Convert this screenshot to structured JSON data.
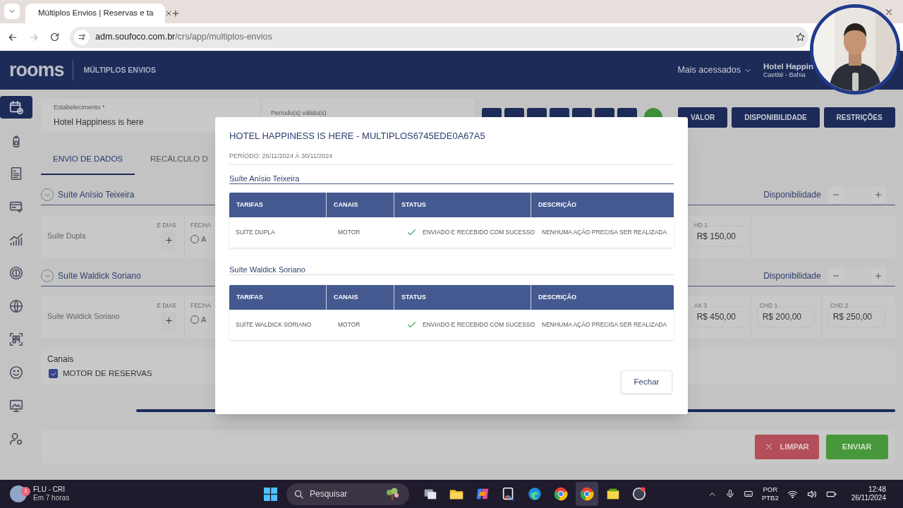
{
  "browser": {
    "tab_title": "Múltiplos Envios | Reservas e ta",
    "url_host": "adm.soufoco.com.br",
    "url_path": "/crs/app/multiplos-envios",
    "forward_disabled": true
  },
  "header": {
    "logo": "rooms",
    "section": "MÚLTIPLOS ENVIOS",
    "menu": "Mais acessados",
    "hotel": "Hotel Happin",
    "city": "Caetité - Bahia"
  },
  "webcam": {
    "kind": "picture"
  },
  "sidebar": {
    "items": [
      {
        "selected": true
      },
      {
        "selected": false
      },
      {
        "selected": false
      },
      {
        "selected": false
      },
      {
        "selected": false
      },
      {
        "selected": false
      },
      {
        "selected": false
      },
      {
        "selected": false
      },
      {
        "selected": false
      },
      {
        "selected": false
      },
      {
        "selected": false
      }
    ]
  },
  "filters": {
    "establishment_label": "Estabelecimento *",
    "establishment_value": "Hotel Happiness is here",
    "period_label": "Período(s) válido(s)"
  },
  "actions": [
    "VALOR",
    "DISPONIBILIDADE",
    "RESTRIÇÕES"
  ],
  "tabs": [
    {
      "label": "ENVIO DE DADOS",
      "selected": true
    },
    {
      "label": "RECÁLCULO D",
      "selected": false
    }
  ],
  "suites": [
    {
      "name": "Suíte Anísio Teixeira",
      "availability_label": "Disponibilidade",
      "rate": "Suite Dupla",
      "days_label": "E DIAS",
      "close_label": "FECHA",
      "option": "A",
      "option_selected": false,
      "prices": [
        {
          "label": "HD 1",
          "value": "R$ 150,00"
        }
      ]
    },
    {
      "name": "Suíte Waldick Soriano",
      "availability_label": "Disponibilidade",
      "rate": "Suite Waldick Soriano",
      "days_label": "E DIAS",
      "close_label": "FECHA",
      "option": "A",
      "option_selected": false,
      "prices": [
        {
          "label": "AX 3",
          "value": "R$ 450,00"
        },
        {
          "label": "CHD 1",
          "value": "R$ 200,00"
        },
        {
          "label": "CHD 2",
          "value": "R$ 250,00"
        }
      ]
    }
  ],
  "channels": {
    "title": "Canais",
    "items": [
      {
        "label": "MOTOR DE RESERVAS",
        "checked": true
      }
    ]
  },
  "footer_buttons": [
    {
      "kind": "clear",
      "label": "LIMPAR"
    },
    {
      "kind": "send",
      "label": "ENVIAR"
    }
  ],
  "modal": {
    "title": "HOTEL HAPPINESS IS HERE - MULTIPLOS6745EDE0A67A5",
    "period": "PERÍODO: 26/11/2024 À 30/11/2024",
    "sections": [
      {
        "name": "Suíte Anísio Teixeira",
        "columns": [
          "TARIFAS",
          "CANAIS",
          "STATUS",
          "DESCRIÇÃO"
        ],
        "rows": [
          {
            "rate": "SUÍTE DUPLA",
            "channel": "MOTOR",
            "status": "ENVIADO E RECEBIDO COM SUCESSO",
            "success": true,
            "description": "NENHUMA AÇÃO PRECISA SER REALIZADA"
          }
        ]
      },
      {
        "name": "Suíte Waldick Soriano",
        "columns": [
          "TARIFAS",
          "CANAIS",
          "STATUS",
          "DESCRIÇÃO"
        ],
        "rows": [
          {
            "rate": "SUÍTE WALDICK SORIANO",
            "channel": "MOTOR",
            "status": "ENVIADO E RECEBIDO COM SUCESSO",
            "success": true,
            "description": "NENHUMA AÇÃO PRECISA SER REALIZADA"
          }
        ]
      }
    ],
    "close_button": "Fechar"
  },
  "taskbar": {
    "weather_badge": "1",
    "weather_title": "FLU - CRI",
    "weather_subtitle": "Em 7 horas",
    "search": "Pesquisar",
    "apps": [
      {
        "selected": false
      },
      {
        "selected": false
      },
      {
        "selected": false
      },
      {
        "selected": false
      },
      {
        "selected": false
      },
      {
        "selected": false
      },
      {
        "selected": true
      },
      {
        "selected": false
      },
      {
        "selected": false
      }
    ],
    "language": "POR",
    "layout": "PTB2",
    "time": "12:48",
    "date": "26/11/2024"
  }
}
